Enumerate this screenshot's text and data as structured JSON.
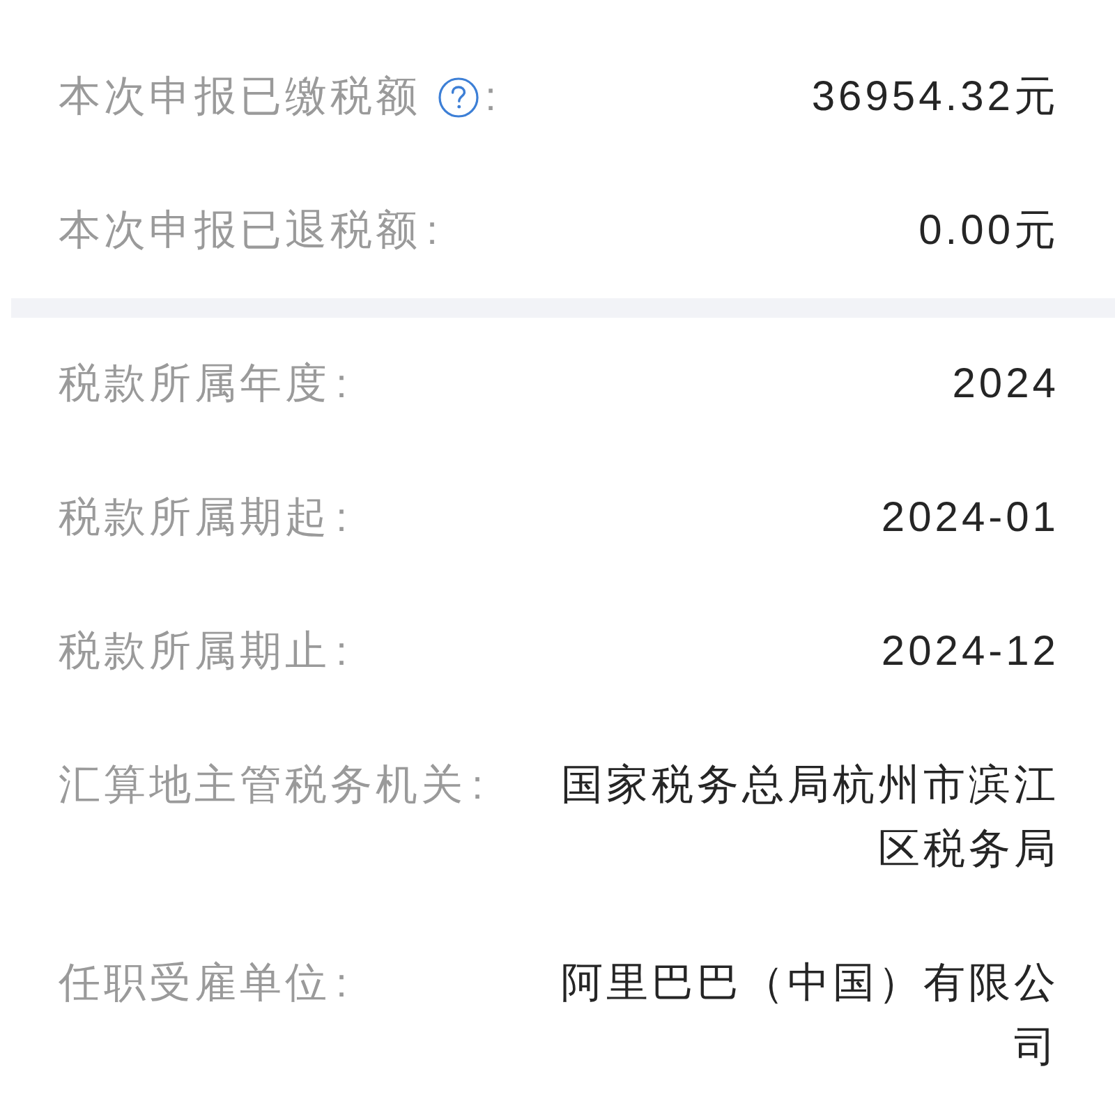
{
  "sections": [
    {
      "rows": [
        {
          "label": "本次申报已缴税额",
          "help": true,
          "separator": ":",
          "value": "36954.32元"
        },
        {
          "label": "本次申报已退税额",
          "help": false,
          "separator": ":",
          "value": "0.00元"
        }
      ]
    },
    {
      "rows": [
        {
          "label": "税款所属年度",
          "help": false,
          "separator": ":",
          "value": "2024"
        },
        {
          "label": "税款所属期起",
          "help": false,
          "separator": ":",
          "value": "2024-01"
        },
        {
          "label": "税款所属期止",
          "help": false,
          "separator": ":",
          "value": "2024-12"
        },
        {
          "label": "汇算地主管税务机关",
          "help": false,
          "separator": ":",
          "value": "国家税务总局杭州市滨江区税务局"
        },
        {
          "label": "任职受雇单位",
          "help": false,
          "separator": ":",
          "value": "阿里巴巴（中国）有限公司"
        }
      ]
    }
  ]
}
